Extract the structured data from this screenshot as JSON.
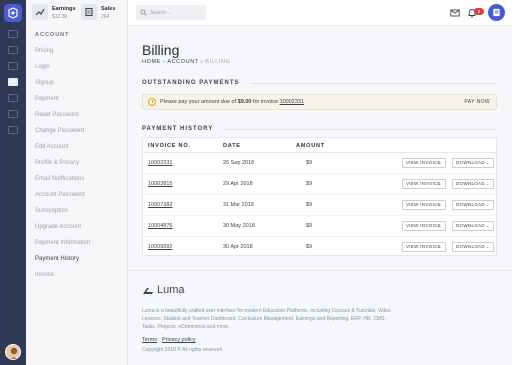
{
  "sidebar": {
    "stats": [
      {
        "label": "Earnings",
        "value": "$12.3k",
        "icon": "trending-up-icon"
      },
      {
        "label": "Sales",
        "value": "264",
        "icon": "receipt-icon"
      }
    ],
    "heading": "ACCOUNT",
    "items": [
      {
        "label": "Pricing"
      },
      {
        "label": "Login"
      },
      {
        "label": "Signup"
      },
      {
        "label": "Payment"
      },
      {
        "label": "Reset Password"
      },
      {
        "label": "Change Password"
      },
      {
        "label": "Edit Account"
      },
      {
        "label": "Profile & Privacy"
      },
      {
        "label": "Email Notifications"
      },
      {
        "label": "Account Password"
      },
      {
        "label": "Subscription"
      },
      {
        "label": "Upgrade Account"
      },
      {
        "label": "Payment Information"
      },
      {
        "label": "Payment History"
      },
      {
        "label": "Invoice"
      }
    ]
  },
  "header": {
    "search_placeholder": "Search ...",
    "notification_count": "2"
  },
  "page": {
    "title": "Billing",
    "breadcrumb": [
      "HOME",
      "ACCOUNT",
      "BILLING"
    ]
  },
  "outstanding": {
    "heading": "OUTSTANDING PAYMENTS",
    "message_pre": "Please pay your amount due of ",
    "amount": "$9.00",
    "message_mid": " for invoice ",
    "invoice": "10002331",
    "action": "PAY NOW"
  },
  "history": {
    "heading": "PAYMENT HISTORY",
    "columns": [
      "INVOICE NO.",
      "DATE",
      "AMOUNT"
    ],
    "view_label": "VIEW INVOICE",
    "download_label": "DOWNLOAD",
    "rows": [
      {
        "invoice": "10002331",
        "date": "26 Sep 2018",
        "amount": "$9"
      },
      {
        "invoice": "10003815",
        "date": "29 Apr 2018",
        "amount": "$9"
      },
      {
        "invoice": "10007382",
        "date": "31 Mar 2018",
        "amount": "$9"
      },
      {
        "invoice": "10004876",
        "date": "30 May 2018",
        "amount": "$9"
      },
      {
        "invoice": "10009392",
        "date": "30 Apr 2018",
        "amount": "$9"
      }
    ]
  },
  "footer": {
    "brand": "Luma",
    "description": "Luma is a beautifully crafted user interface for modern Education Platforms, including Courses & Tutorials, Video Lessons, Student and Teacher Dashboard, Curriculum Management, Earnings and Reporting, ERP, HR, CMS, Tasks, Projects, eCommerce and more.",
    "links": [
      "Terms",
      "Privacy policy"
    ],
    "copyright": "Copyright 2019 © All rights reserved"
  }
}
